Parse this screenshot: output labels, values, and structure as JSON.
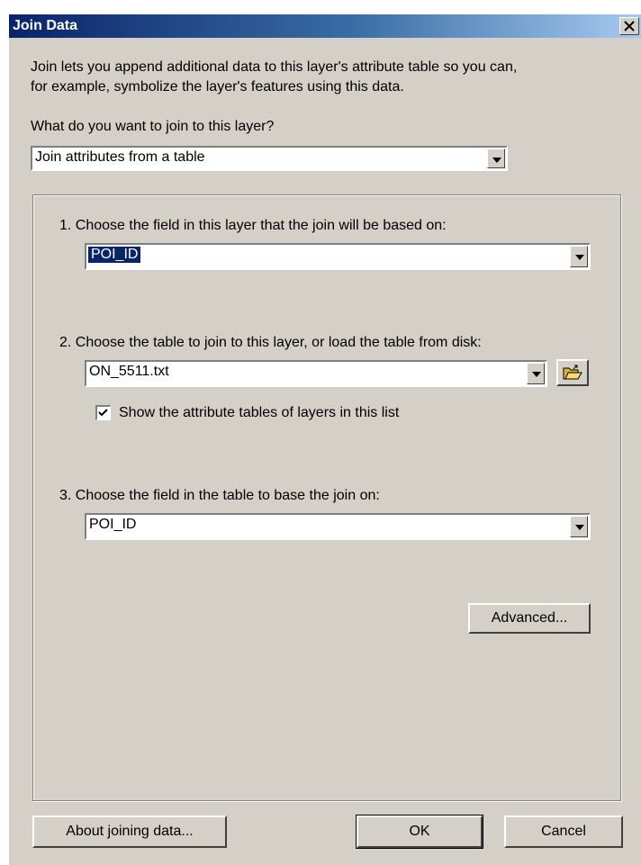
{
  "window": {
    "title": "Join Data",
    "close_label": "x"
  },
  "intro_text": {
    "line1": "Join lets you append additional data to this layer's attribute table so you can,",
    "line2": "for example, symbolize the layer's features using this data."
  },
  "join_type": {
    "question": "What do you want to join to this layer?",
    "selected": "Join attributes from a table"
  },
  "step1": {
    "label": "1.  Choose the field in this layer that the join will be based on:",
    "selected": "POI_ID"
  },
  "step2": {
    "label": "2.  Choose the table to join to this layer, or load the table from disk:",
    "selected": "ON_5511.txt",
    "checkbox_label": "Show the attribute tables of layers in this list",
    "checkbox_checked": true
  },
  "step3": {
    "label": "3.  Choose the field in the table to base the join on:",
    "selected": "POI_ID"
  },
  "buttons": {
    "advanced": "Advanced...",
    "about": "About joining data...",
    "ok": "OK",
    "cancel": "Cancel"
  },
  "icons": {
    "browse": "open-folder-icon",
    "dropdown": "chevron-down-icon",
    "check": "checkmark-icon"
  },
  "colors": {
    "title_bar": "#0a246a",
    "highlight": "#0a246a",
    "dialog_bg": "#d4d0c8"
  }
}
